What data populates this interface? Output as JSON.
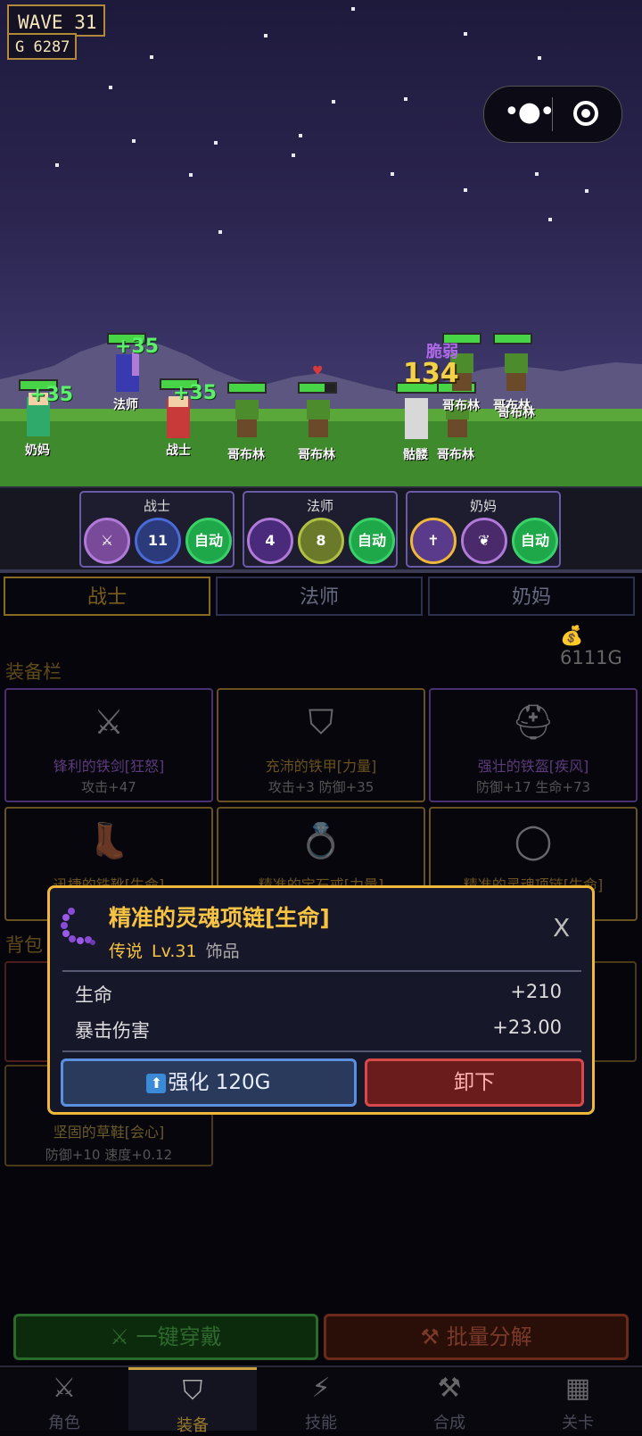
{
  "hud": {
    "wave": "WAVE  31",
    "gold": "G 6287"
  },
  "battle": {
    "floating": {
      "heal": "+35",
      "damage": "134",
      "status": "脆弱"
    },
    "units": {
      "nurse": "奶妈",
      "mage": "法师",
      "warrior": "战士",
      "goblin": "哥布林",
      "skeleton": "骷髅"
    }
  },
  "skill_panels": [
    {
      "title": "战士",
      "icons": [
        {
          "name": "sword-skill-icon",
          "text": "⚔"
        },
        {
          "name": "shield-skill-icon",
          "text": "11"
        }
      ],
      "auto": "自动"
    },
    {
      "title": "法师",
      "icons": [
        {
          "name": "sparkle-skill-icon",
          "text": "4"
        },
        {
          "name": "lightning-skill-icon",
          "text": "8"
        }
      ],
      "auto": "自动"
    },
    {
      "title": "奶妈",
      "icons": [
        {
          "name": "cross-skill-icon",
          "text": "✝"
        },
        {
          "name": "leaf-skill-icon",
          "text": "❦"
        }
      ],
      "auto": "自动"
    }
  ],
  "tabs": [
    "战士",
    "法师",
    "奶妈"
  ],
  "money": "6111G",
  "sections": {
    "equip": "装备栏",
    "bag": "背包"
  },
  "equipment": [
    {
      "icon": "sword-icon",
      "glyph": "⚔",
      "name": "锋利的铁剑[狂怒]",
      "stat": "攻击+47",
      "rarity": "purple"
    },
    {
      "icon": "shield-icon",
      "glyph": "⛉",
      "name": "充沛的铁甲[力量]",
      "stat": "攻击+3 防御+35",
      "rarity": "gold"
    },
    {
      "icon": "helmet-icon",
      "glyph": "⛑",
      "name": "强壮的铁盔[疾风]",
      "stat": "防御+17 生命+73",
      "rarity": "purple"
    },
    {
      "icon": "boot-icon",
      "glyph": "👢",
      "name": "迅捷的铁靴[生命]",
      "stat": "",
      "rarity": "gold"
    },
    {
      "icon": "ring-icon",
      "glyph": "💍",
      "name": "精准的宝石戒[力量]",
      "stat": "",
      "rarity": "gold"
    },
    {
      "icon": "necklace-icon",
      "glyph": "◯",
      "name": "精准的灵魂项链[生命]",
      "stat": "",
      "rarity": "gold"
    }
  ],
  "bag_item": {
    "name": "坚固的草鞋[会心]",
    "stat": "防御+10 速度+0.12"
  },
  "popup": {
    "title": "精准的灵魂项链[生命]",
    "rarity": "传说",
    "level": "Lv.31",
    "type": "饰品",
    "close": "X",
    "stats": [
      {
        "label": "生命",
        "value": "+210"
      },
      {
        "label": "暴击伤害",
        "value": "+23.00"
      }
    ],
    "enhance": "强化 120G",
    "unequip": "卸下"
  },
  "actions": {
    "wear": "⚔ 一键穿戴",
    "salvage": "⚒ 批量分解"
  },
  "nav": [
    {
      "label": "角色",
      "icon": "crossed-swords-icon",
      "glyph": "⚔"
    },
    {
      "label": "装备",
      "icon": "shield-icon",
      "glyph": "⛉"
    },
    {
      "label": "技能",
      "icon": "lightning-icon",
      "glyph": "⚡"
    },
    {
      "label": "合成",
      "icon": "hammer-icon",
      "glyph": "⚒"
    },
    {
      "label": "关卡",
      "icon": "map-icon",
      "glyph": "▦"
    }
  ],
  "colors": {
    "accent": "#f0b83a",
    "heal": "#5df06c",
    "damage": "#f2d24a",
    "danger": "#d84a4a",
    "info": "#5b8fe0"
  }
}
